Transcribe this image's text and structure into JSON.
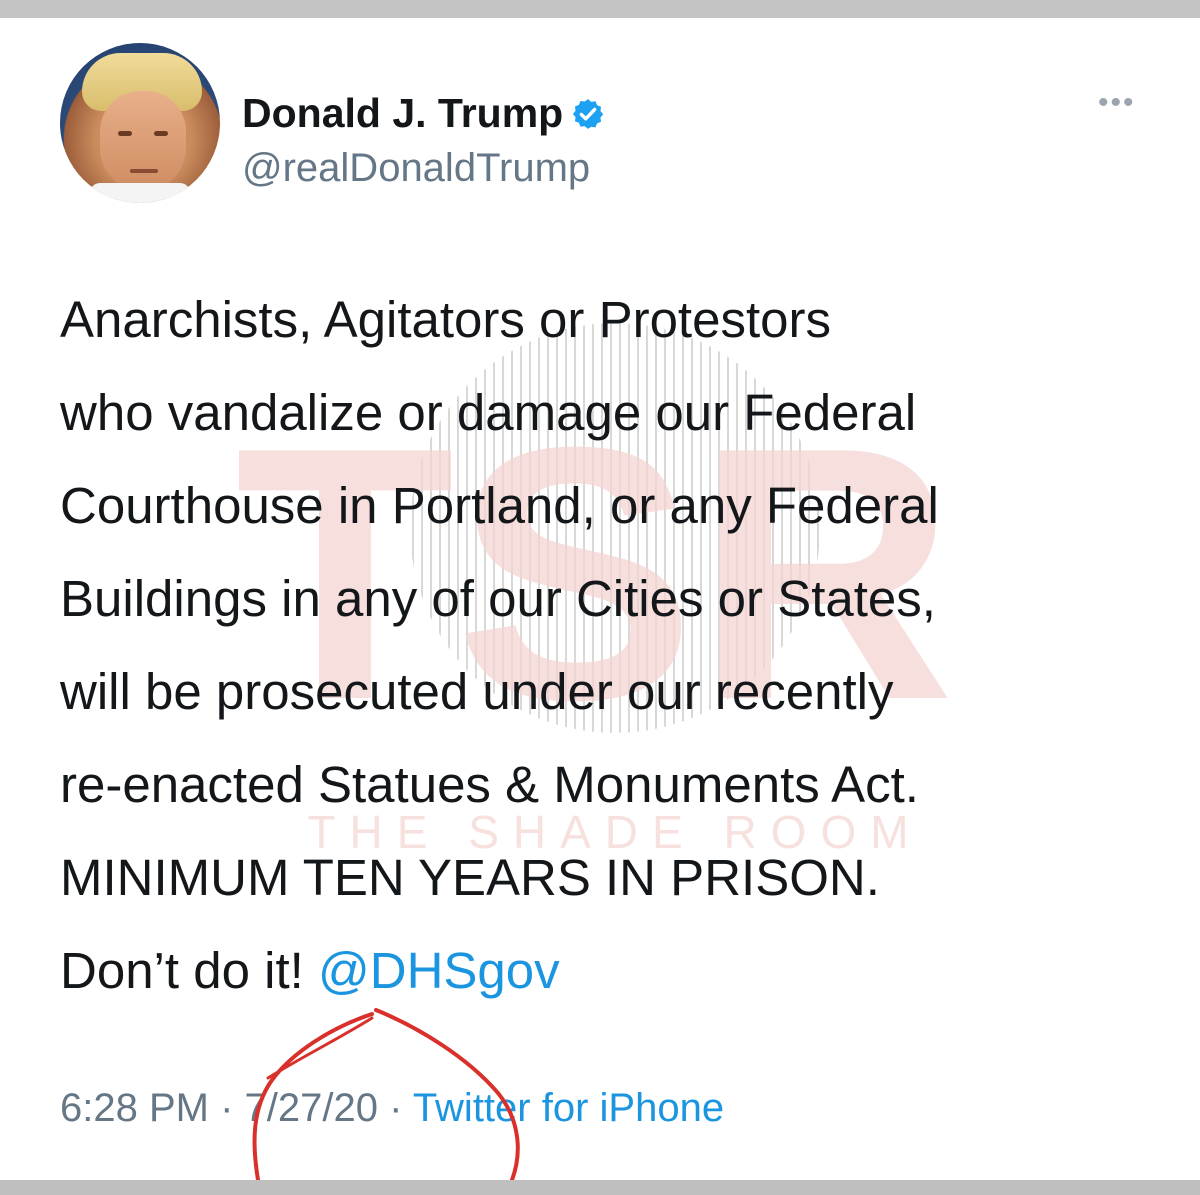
{
  "tweet": {
    "display_name": "Donald J. Trump",
    "handle": "@realDonaldTrump",
    "verified": true,
    "more_menu_icon": "more-horizontal-icon",
    "text_lines": [
      "Anarchists, Agitators or Protestors",
      "who vandalize or damage our Federal",
      "Courthouse in Portland, or any Federal",
      "Buildings in any of our Cities or States,",
      "will be prosecuted under our recently",
      "re-enacted Statues & Monuments Act.",
      "MINIMUM TEN YEARS IN PRISON."
    ],
    "last_line_prefix": "Don’t do it! ",
    "mention": "@DHSgov",
    "time": "6:28 PM",
    "separator": " · ",
    "date": "7/27/20",
    "source": "Twitter for iPhone"
  },
  "watermark": {
    "letters": "TSR",
    "caption": "THE SHADE ROOM"
  },
  "colors": {
    "text": "#14171a",
    "secondary": "#657786",
    "link": "#1b95e0",
    "verified": "#1da1f2",
    "annotation": "#d9302b",
    "watermark": "#f3d4d0"
  }
}
